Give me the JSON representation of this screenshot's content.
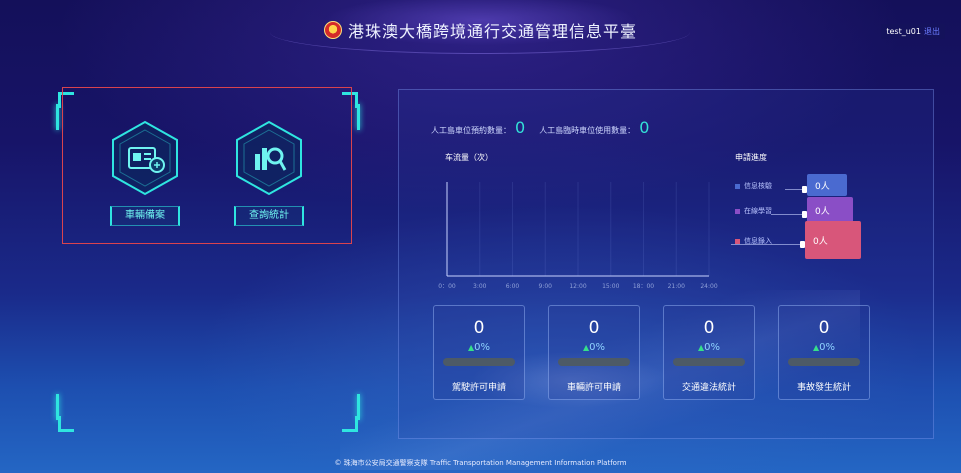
{
  "header": {
    "title": "港珠澳大橋跨境通行交通管理信息平臺",
    "emblem_icon": "police-emblem-icon",
    "username": "test_u01",
    "logout_label": "退出"
  },
  "left_panel": {
    "tiles": [
      {
        "label": "車輛備案",
        "icon": "vehicle-registration-icon"
      },
      {
        "label": "查詢統計",
        "icon": "query-statistics-icon"
      }
    ]
  },
  "counts": {
    "reserved_label": "人工島車位預約數量：",
    "reserved_value": "0",
    "temp_label": "人工島臨時車位使用數量：",
    "temp_value": "0"
  },
  "traffic_chart": {
    "title": "车流量（次）"
  },
  "chart_data": {
    "type": "line",
    "x": [
      "0：00",
      "3:00",
      "6:00",
      "9:00",
      "12:00",
      "15:00",
      "18：00",
      "21:00",
      "24:00"
    ],
    "series": [],
    "ylim": [
      0,
      1
    ],
    "grid": true
  },
  "progress": {
    "title": "申請進度",
    "rows": [
      {
        "label": "信息核驗",
        "value": "0人",
        "color": "#4a6ad0"
      },
      {
        "label": "在線學習",
        "value": "0人",
        "color": "#8a4ec6"
      },
      {
        "label": "信息錄入",
        "value": "0人",
        "color": "#d8567a"
      }
    ]
  },
  "stats": [
    {
      "value": "0",
      "pct": "0%",
      "label": "駕駛許可申請"
    },
    {
      "value": "0",
      "pct": "0%",
      "label": "車輛許可申請"
    },
    {
      "value": "0",
      "pct": "0%",
      "label": "交通違法統計"
    },
    {
      "value": "0",
      "pct": "0%",
      "label": "事故發生統計"
    }
  ],
  "footer": {
    "text": "© 珠海市公安局交通警察支隊 Traffic Transportation Management Information Platform"
  }
}
